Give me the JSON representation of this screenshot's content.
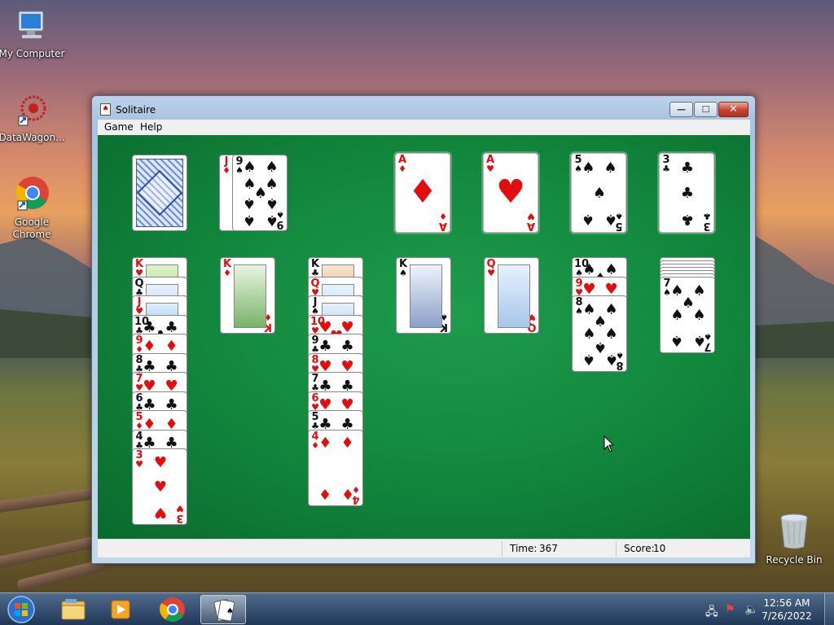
{
  "desktop": {
    "icons": [
      {
        "label": "My Computer"
      },
      {
        "label": "DataWagon..."
      },
      {
        "label": "Google Chrome"
      },
      {
        "label": "Recycle Bin"
      }
    ]
  },
  "window": {
    "title": "Solitaire",
    "menu": [
      "Game",
      "Help"
    ],
    "status": {
      "time_label": "Time:",
      "time_value": "367",
      "score_label": "Score:",
      "score_value": "10"
    }
  },
  "game": {
    "stock": {
      "face_down": true
    },
    "waste": [
      {
        "rank": "J",
        "suit": "♦"
      },
      {
        "rank": "9",
        "suit": "♠"
      }
    ],
    "foundations": [
      {
        "rank": "A",
        "suit": "♦"
      },
      {
        "rank": "A",
        "suit": "♥"
      },
      {
        "rank": "5",
        "suit": "♠"
      },
      {
        "rank": "3",
        "suit": "♣"
      }
    ],
    "tableau": [
      {
        "face_down": 0,
        "cards": [
          {
            "rank": "K",
            "suit": "♥"
          },
          {
            "rank": "Q",
            "suit": "♣"
          },
          {
            "rank": "J",
            "suit": "♥"
          },
          {
            "rank": "10",
            "suit": "♣"
          },
          {
            "rank": "9",
            "suit": "♦"
          },
          {
            "rank": "8",
            "suit": "♣"
          },
          {
            "rank": "7",
            "suit": "♥"
          },
          {
            "rank": "6",
            "suit": "♣"
          },
          {
            "rank": "5",
            "suit": "♦"
          },
          {
            "rank": "4",
            "suit": "♣"
          },
          {
            "rank": "3",
            "suit": "♥"
          }
        ]
      },
      {
        "face_down": 0,
        "cards": [
          {
            "rank": "K",
            "suit": "♦"
          }
        ]
      },
      {
        "face_down": 0,
        "cards": [
          {
            "rank": "K",
            "suit": "♣"
          },
          {
            "rank": "Q",
            "suit": "♥"
          },
          {
            "rank": "J",
            "suit": "♠"
          },
          {
            "rank": "10",
            "suit": "♥"
          },
          {
            "rank": "9",
            "suit": "♣"
          },
          {
            "rank": "8",
            "suit": "♥"
          },
          {
            "rank": "7",
            "suit": "♣"
          },
          {
            "rank": "6",
            "suit": "♥"
          },
          {
            "rank": "5",
            "suit": "♣"
          },
          {
            "rank": "4",
            "suit": "♦"
          }
        ]
      },
      {
        "face_down": 0,
        "cards": [
          {
            "rank": "K",
            "suit": "♠"
          }
        ]
      },
      {
        "face_down": 0,
        "cards": [
          {
            "rank": "Q",
            "suit": "♥"
          }
        ]
      },
      {
        "face_down": 0,
        "cards": [
          {
            "rank": "10",
            "suit": "♠"
          },
          {
            "rank": "9",
            "suit": "♥"
          },
          {
            "rank": "8",
            "suit": "♠"
          }
        ]
      },
      {
        "face_down": 6,
        "cards": [
          {
            "rank": "7",
            "suit": "♠"
          }
        ]
      }
    ]
  },
  "taskbar": {
    "clock_time": "12:56 AM",
    "clock_date": "7/26/2022",
    "pinned": [
      "start-orb-icon",
      "explorer-icon",
      "media-player-icon",
      "chrome-icon",
      "solitaire-icon"
    ]
  },
  "colors": {
    "felt": "#138a3f",
    "red_suit": "#e30d0d",
    "black_suit": "#111111"
  }
}
